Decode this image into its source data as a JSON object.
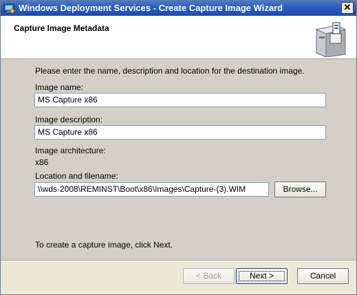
{
  "window": {
    "title": "Windows Deployment Services - Create Capture Image Wizard",
    "close_glyph": "✕"
  },
  "header": {
    "title": "Capture Image Metadata"
  },
  "form": {
    "intro": "Please enter the name, description and location for the destination image.",
    "image_name_label": "Image name:",
    "image_name_value": "MS Capture  x86",
    "image_description_label": "Image description:",
    "image_description_value": "MS Capture x86",
    "architecture_label": "Image architecture:",
    "architecture_value": "x86",
    "location_label": "Location and filename:",
    "location_value": "\\\\wds-2008\\REMINST\\Boot\\x86\\Images\\Capture-(3).WIM",
    "browse_label": "Browse...",
    "footer_hint": "To create a capture image, click Next."
  },
  "buttons": {
    "back_label": "< Back",
    "next_label": "Next >",
    "cancel_label": "Cancel"
  },
  "colors": {
    "titlebar": "#2a5cbd",
    "panel": "#d4d0c8"
  },
  "icons": {
    "app": "wds-app-icon",
    "header": "cabinet-drawer-icon"
  }
}
